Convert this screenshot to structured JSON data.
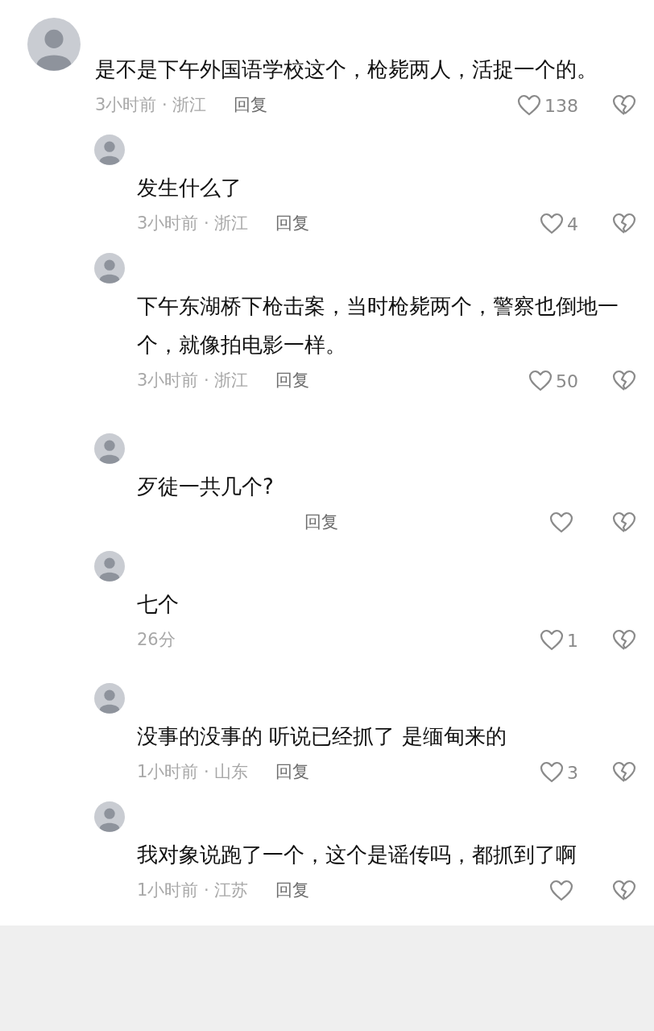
{
  "comments": [
    {
      "kind": "top",
      "text": "是不是下午外国语学校这个，枪毙两人，活捉一个的。",
      "time": "3小时前 · 浙江",
      "reply": "回复",
      "likes": "138"
    },
    {
      "kind": "reply",
      "text": "发生什么了",
      "time": "3小时前 · 浙江",
      "reply": "回复",
      "likes": "4"
    },
    {
      "kind": "reply",
      "text": "下午东湖桥下枪击案，当时枪毙两个，警察也倒地一个，就像拍电影一样。",
      "time": "3小时前 · 浙江",
      "reply": "回复",
      "likes": "50"
    },
    {
      "kind": "reply",
      "text": "歹徒一共几个?",
      "reply": "回复"
    },
    {
      "kind": "reply",
      "text": "七个",
      "time": "26分",
      "likes": "1"
    },
    {
      "kind": "reply",
      "text": "没事的没事的 听说已经抓了 是缅甸来的",
      "time": "1小时前 · 山东",
      "reply": "回复",
      "likes": "3"
    },
    {
      "kind": "reply",
      "text": "我对象说跑了一个，这个是谣传吗，都抓到了啊",
      "time": "1小时前 · 江苏",
      "reply": "回复"
    }
  ]
}
